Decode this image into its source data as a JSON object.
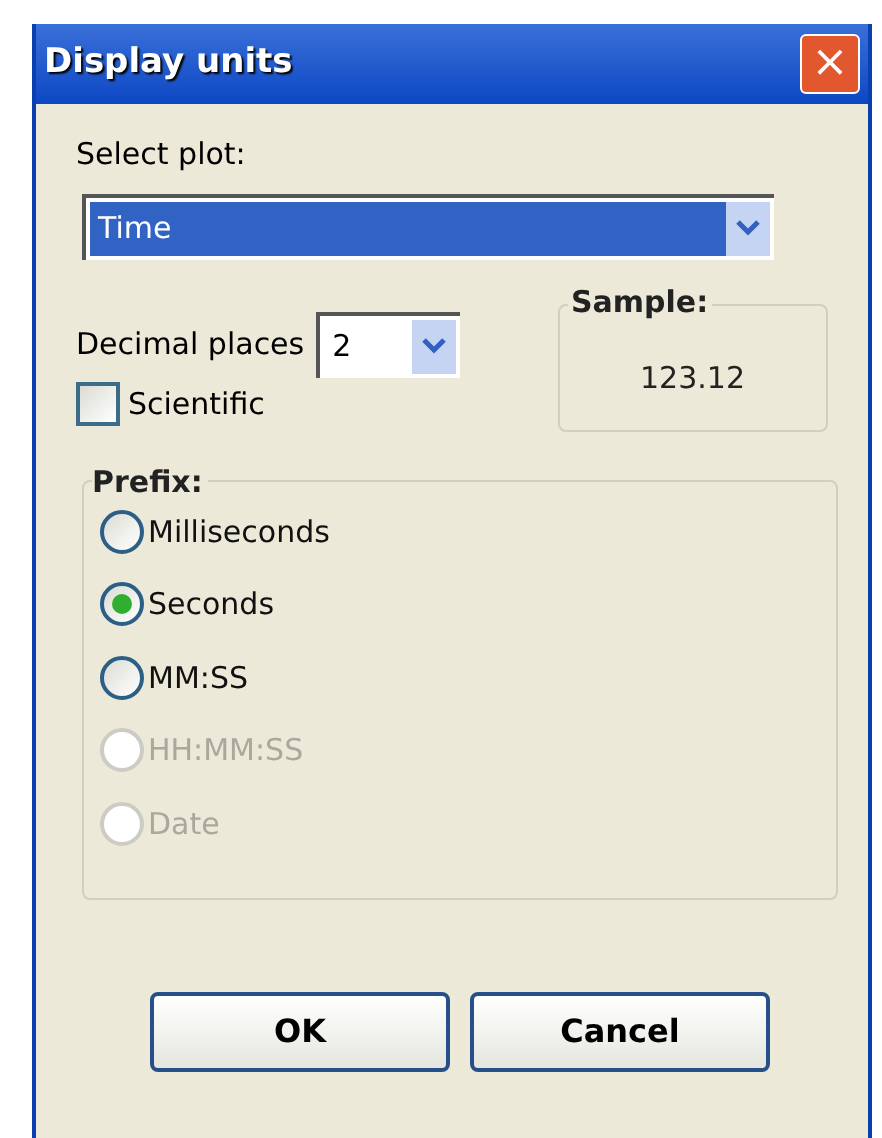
{
  "window": {
    "title": "Display units",
    "close": "×"
  },
  "select_plot": {
    "label": "Select plot:",
    "value": "Time"
  },
  "decimal_places": {
    "label": "Decimal places",
    "value": "2"
  },
  "scientific": {
    "label": "Scientific",
    "checked": false
  },
  "sample": {
    "label": "Sample:",
    "value": "123.12"
  },
  "prefix": {
    "label": "Prefix:",
    "options": [
      {
        "label": "Milliseconds",
        "selected": false,
        "disabled": false
      },
      {
        "label": "Seconds",
        "selected": true,
        "disabled": false
      },
      {
        "label": "MM:SS",
        "selected": false,
        "disabled": false
      },
      {
        "label": "HH:MM:SS",
        "selected": false,
        "disabled": true
      },
      {
        "label": "Date",
        "selected": false,
        "disabled": true
      }
    ]
  },
  "buttons": [
    "OK",
    "Cancel"
  ]
}
